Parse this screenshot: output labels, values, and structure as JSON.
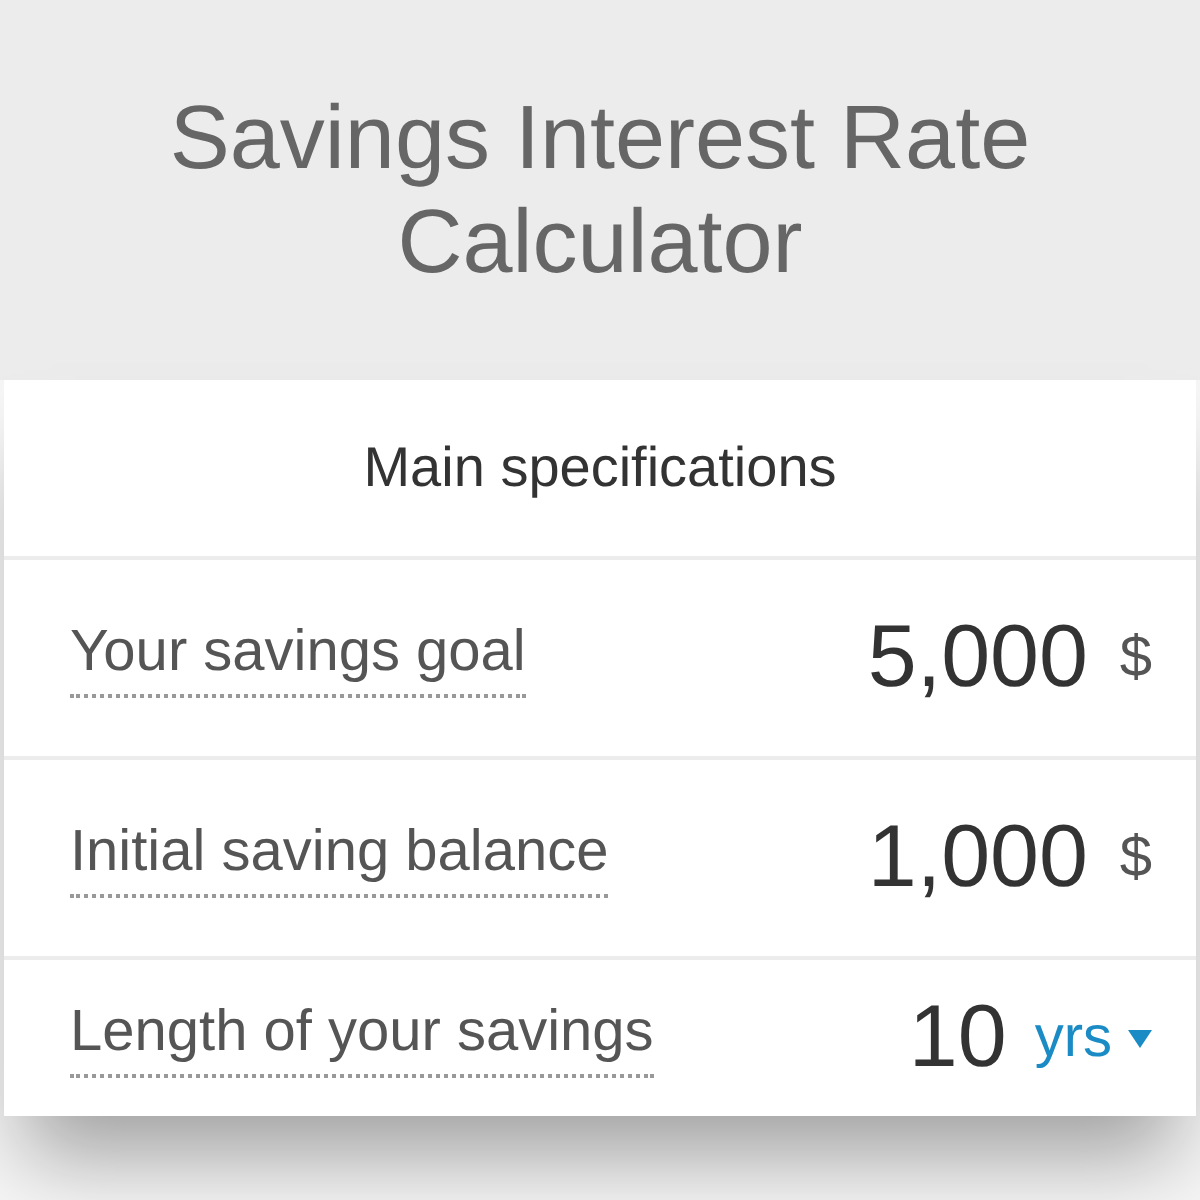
{
  "title": "Savings Interest Rate Calculator",
  "section": {
    "title": "Main specifications"
  },
  "fields": [
    {
      "label": "Your savings goal",
      "value": "5,000",
      "unit": "$",
      "kind": "text"
    },
    {
      "label": "Initial saving balance",
      "value": "1,000",
      "unit": "$",
      "kind": "text"
    },
    {
      "label": "Length of your savings",
      "value": "10",
      "unit": "yrs",
      "kind": "dropdown"
    }
  ]
}
